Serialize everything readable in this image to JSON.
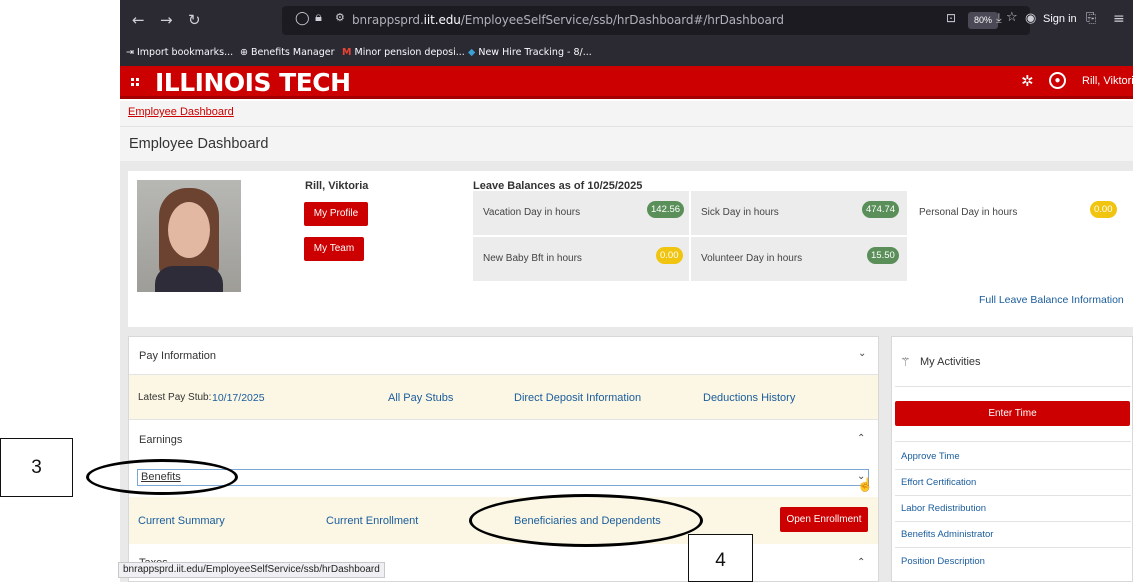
{
  "browser": {
    "url_prefix": "bnrappsprd.",
    "url_host": "iit.edu",
    "url_path": "/EmployeeSelfService/ssb/hrDashboard#/hrDashboard",
    "zoom": "80%",
    "sign_in": "Sign in",
    "bookmarks": [
      "Import bookmarks...",
      "Benefits Manager",
      "Minor pension deposi...",
      "New Hire Tracking - 8/..."
    ],
    "status_url": "bnrappsprd.iit.edu/EmployeeSelfService/ssb/hrDashboard"
  },
  "header": {
    "logo": "ILLINOIS TECH",
    "user_name": "Rill, Viktori"
  },
  "breadcrumb": "Employee Dashboard",
  "page_title": "Employee Dashboard",
  "profile": {
    "name": "Rill, Viktoria",
    "my_profile": "My Profile",
    "my_team": "My Team"
  },
  "leave": {
    "title": "Leave Balances as of 10/25/2025",
    "items": [
      {
        "label": "Vacation Day in hours",
        "value": "142.56"
      },
      {
        "label": "Sick Day in hours",
        "value": "474.74"
      },
      {
        "label": "Personal Day in hours",
        "value": "0.00"
      },
      {
        "label": "New Baby Bft in hours",
        "value": "0.00"
      },
      {
        "label": "Volunteer Day in hours",
        "value": "15.50"
      }
    ],
    "full_link": "Full Leave Balance Information"
  },
  "pay": {
    "header": "Pay Information",
    "latest_label": "Latest Pay Stub:",
    "latest_date": "10/17/2025",
    "all_stubs": "All Pay Stubs",
    "direct_deposit": "Direct Deposit Information",
    "deductions": "Deductions History"
  },
  "earnings": {
    "header": "Earnings"
  },
  "benefits": {
    "header": "Benefits",
    "current_summary": "Current Summary",
    "current_enrollment": "Current Enrollment",
    "beneficiaries": "Beneficiaries and Dependents",
    "open_enrollment": "Open Enrollment"
  },
  "taxes": {
    "header": "Taxes"
  },
  "activities": {
    "header": "My Activities",
    "enter_time": "Enter Time",
    "items": [
      "Approve Time",
      "Effort Certification",
      "Labor Redistribution",
      "Benefits Administrator",
      "Position Description"
    ]
  },
  "annotations": {
    "box3": "3",
    "box4": "4"
  },
  "colors": {
    "brand_red": "#cc0000",
    "link_blue": "#1a5c9c",
    "pill_green": "#5a8f5a",
    "pill_yellow": "#f1c40f"
  }
}
